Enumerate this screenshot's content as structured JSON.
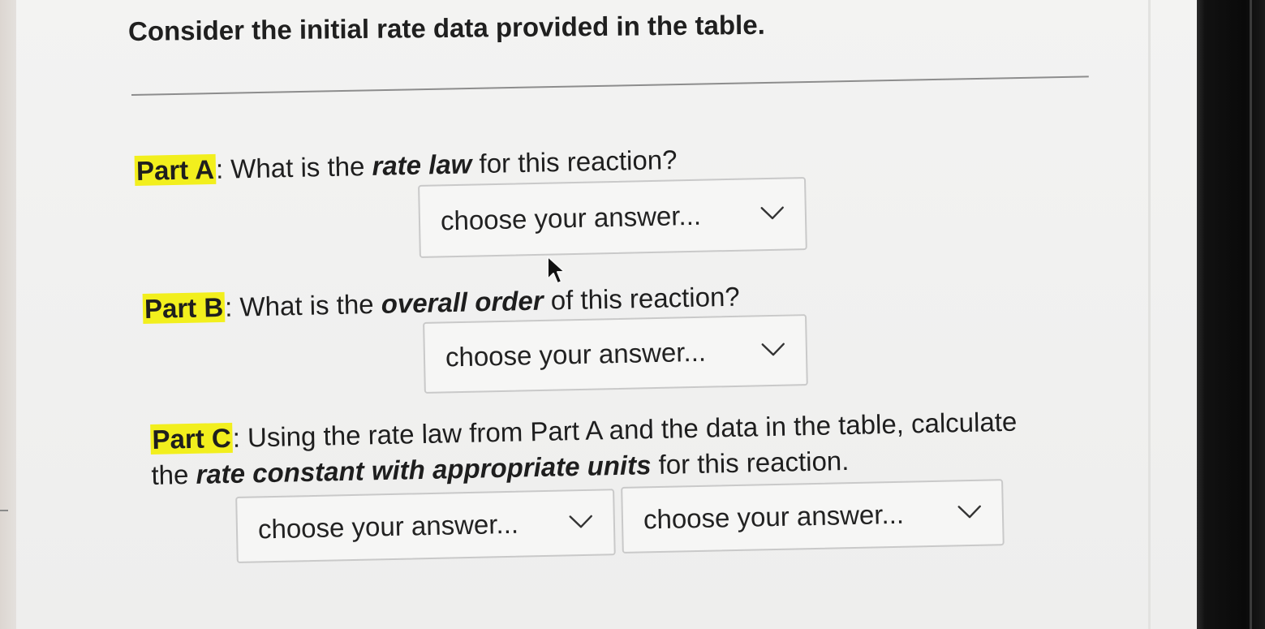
{
  "title": "Consider the initial rate data provided in the table.",
  "parts": {
    "a": {
      "label": "Part A",
      "text_before": ": What is the ",
      "emphasis": "rate law",
      "text_after": " for this reaction?",
      "select_value": "choose your answer..."
    },
    "b": {
      "label": "Part B",
      "text_before": ": What is the ",
      "emphasis": "overall order",
      "text_after": " of this reaction?",
      "select_value": "choose your answer..."
    },
    "c": {
      "label": "Part C",
      "line1_text": ": Using the rate law from Part A and the data in the table, calculate",
      "line2_before": "the ",
      "emphasis": "rate constant with appropriate units",
      "line2_after": " for this reaction.",
      "select_value_1": "choose your answer...",
      "select_value_2": "choose your answer..."
    }
  },
  "icons": {
    "dropdown": "chevron-down-icon",
    "cursor": "mouse-pointer-icon"
  },
  "colors": {
    "highlight": "#f2ef1d",
    "border": "#c9c9c9"
  }
}
